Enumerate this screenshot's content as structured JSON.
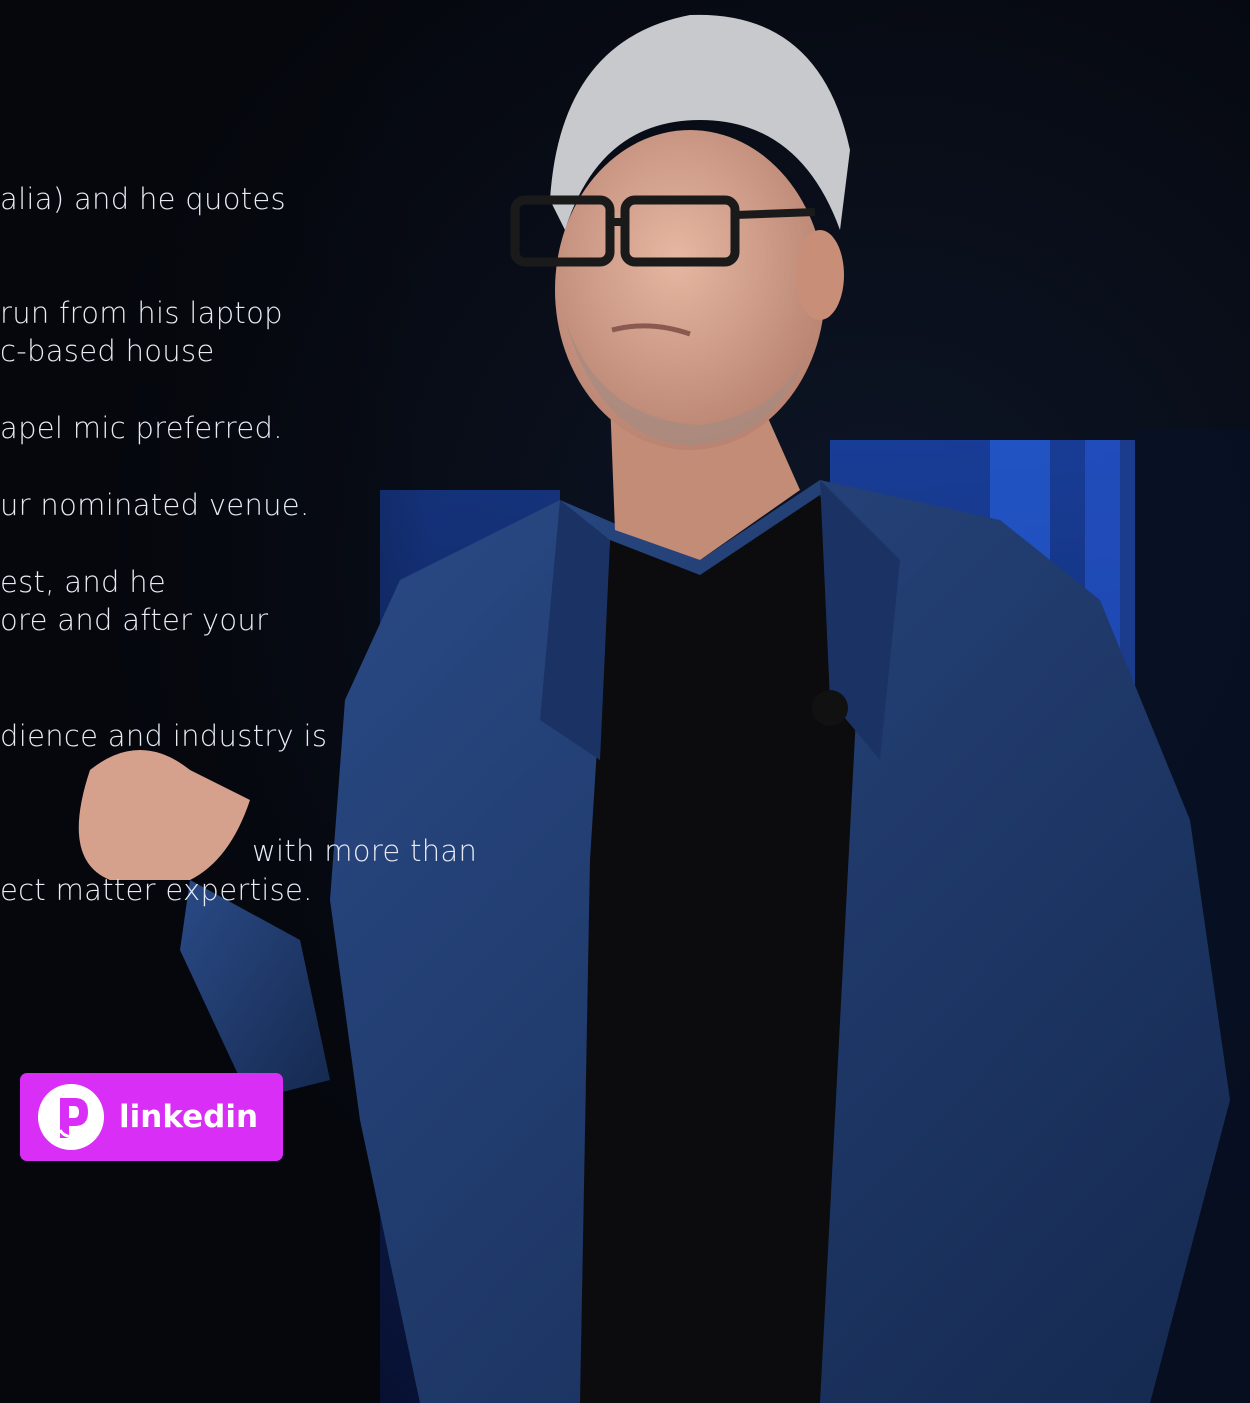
{
  "text_lines": [
    "alia) and he quotes",
    " run from his laptop",
    "c-based house",
    "apel mic preferred.",
    "ur nominated venue.",
    "est, and he",
    "ore and after your",
    "dience and industry is",
    "with more than",
    "ect matter expertise."
  ],
  "linkedin_button": {
    "label": "linkedin",
    "icon": "p-logo-icon",
    "color": "#d92ef5"
  },
  "photo": {
    "subject": "presenter-on-stage"
  }
}
